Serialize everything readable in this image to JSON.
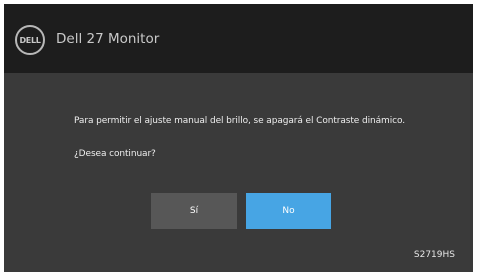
{
  "header": {
    "logo_text": "DELL",
    "title": "Dell 27 Monitor"
  },
  "dialog": {
    "message": "Para permitir el ajuste manual del brillo, se apagará el Contraste dinámico.",
    "question": "¿Desea continuar?",
    "yes_label": "Sí",
    "no_label": "No"
  },
  "footer": {
    "model": "S2719HS"
  },
  "colors": {
    "panel": "#3a3a3a",
    "header": "#1d1d1d",
    "accent": "#47a5e4",
    "button_secondary": "#575757"
  }
}
